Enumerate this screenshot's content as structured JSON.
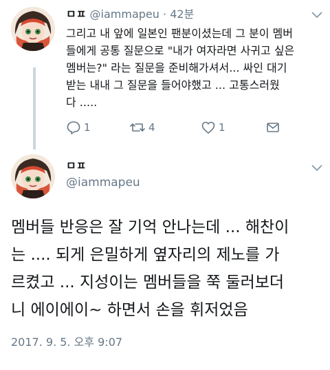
{
  "tweet1": {
    "name": "ㅁㅍ",
    "handle": "@iammapeu",
    "separator": "·",
    "time": "42분",
    "lines": [
      "그리고 내 앞에 일본인 팬분이셨는데 그 분이 멤버",
      "들에게 공통 질문으로 \"내가 여자라면 사귀고 싶은",
      "멤버는?\" 라는 질문을 준비해가셔서... 싸인 대기",
      "받는 내내 그 질문을 들어야했고 ... 고통스러웠",
      "다 ....."
    ],
    "actions": {
      "reply_count": "1",
      "retweet_count": "4",
      "like_count": "1"
    }
  },
  "tweet2": {
    "name": "ㅁㅍ",
    "handle": "@iammapeu",
    "lines": [
      "멤버들 반응은 잘 기억 안나는데 ... 해찬이",
      "는 .... 되게 은밀하게 옆자리의 제노를 가",
      "르켰고 ... 지성이는 멤버들을 쭉 둘러보더",
      "니 에이에이~ 하면서 손을 휘저었음"
    ],
    "timestamp": "2017. 9. 5. 오후 9:07"
  },
  "colors": {
    "text": "#14171a",
    "muted": "#657786",
    "thread_line": "#ccd6dd"
  }
}
